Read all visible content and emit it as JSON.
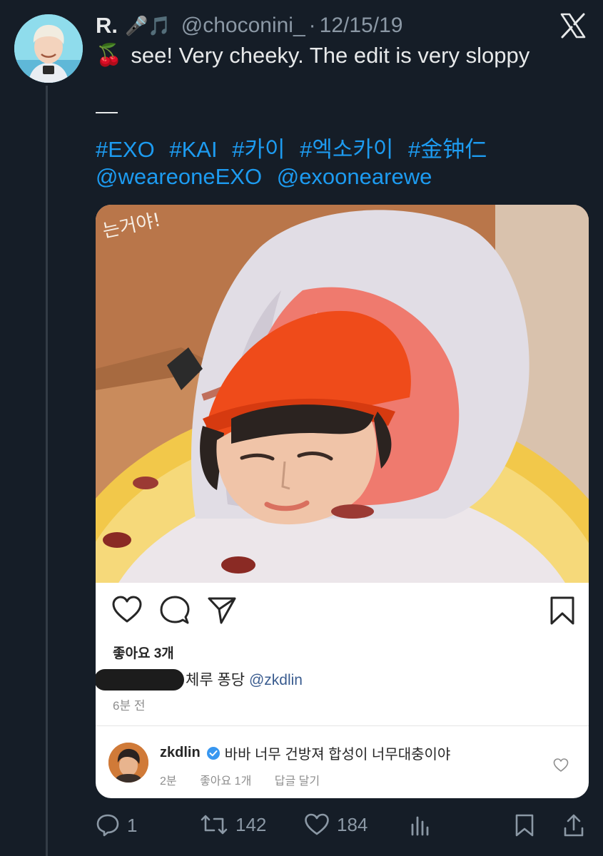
{
  "tweet": {
    "author_name": "R.",
    "author_emoji": "🎤🎵",
    "handle": "@choconini_",
    "separator": "·",
    "date": "12/15/19",
    "cherry_emoji": "🍒",
    "text": "see! Very cheeky. The edit is very sloppy",
    "dash": "—",
    "hashtags": [
      "#EXO",
      "#KAI",
      "#카이",
      "#엑소카이",
      "#金钟仁"
    ],
    "mentions": [
      "@weareoneEXO",
      "@exoonearewe"
    ]
  },
  "embedded_post": {
    "photo_sign_text": "는거야!",
    "likes": "좋아요 3개",
    "caption_text": "체루 퐁당",
    "caption_mention": "@zkdlin",
    "time_ago": "6분 전",
    "comment": {
      "username": "zkdlin",
      "text": "바바 너무 건방져 합성이 너무대충이야",
      "time": "2분",
      "likes": "좋아요 1개",
      "reply": "답글 달기"
    }
  },
  "actions": {
    "replies": "1",
    "retweets": "142",
    "likes": "184"
  },
  "colors": {
    "background": "#151d27",
    "link": "#1d9bf0",
    "muted": "#8b98a5"
  },
  "icons": [
    "x-logo-icon",
    "heart-icon",
    "comment-icon",
    "send-icon",
    "bookmark-icon",
    "verified-icon",
    "reply-icon",
    "retweet-icon",
    "views-icon",
    "share-icon"
  ]
}
